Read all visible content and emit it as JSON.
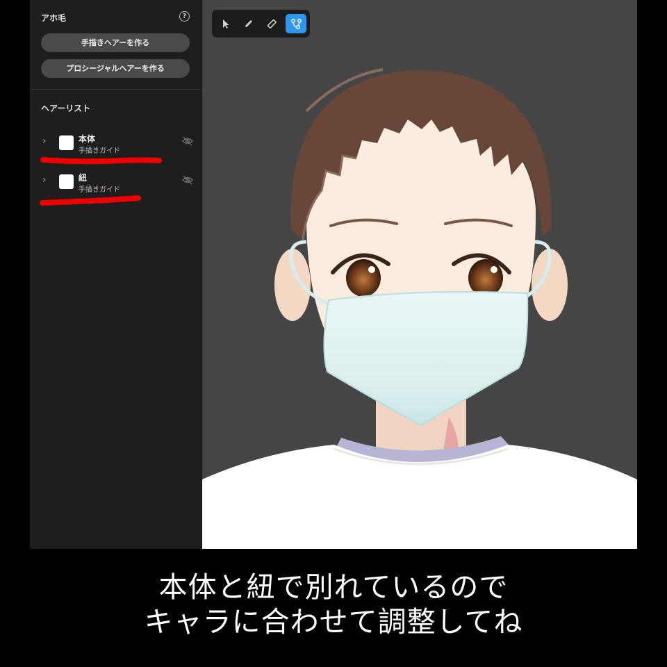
{
  "sidebar": {
    "ahoge_title": "アホ毛",
    "help_glyph": "?",
    "buttons": {
      "hand_drawn_label": "手描きヘアーを作る",
      "procedural_label": "プロシージャルヘアーを作る"
    },
    "hair_list_title": "ヘアーリスト",
    "hair_items": [
      {
        "name": "本体",
        "subtitle": "手描きガイド",
        "swatch_color": "#ffffff"
      },
      {
        "name": "紐",
        "subtitle": "手描きガイド",
        "swatch_color": "#ffffff"
      }
    ]
  },
  "toolbar": {
    "tools": [
      {
        "icon": "cursor-icon",
        "active": false
      },
      {
        "icon": "pencil-icon",
        "active": false
      },
      {
        "icon": "eraser-icon",
        "active": false
      },
      {
        "icon": "bezier-path-icon",
        "active": true
      }
    ]
  },
  "caption": {
    "line1": "本体と紐で別れているので",
    "line2": "キャラに合わせて調整してね"
  },
  "colors": {
    "highlight": "#ee0000",
    "accent": "#2d97f0",
    "viewport_bg": "#454545",
    "sidebar_bg": "#1e1e1e"
  }
}
